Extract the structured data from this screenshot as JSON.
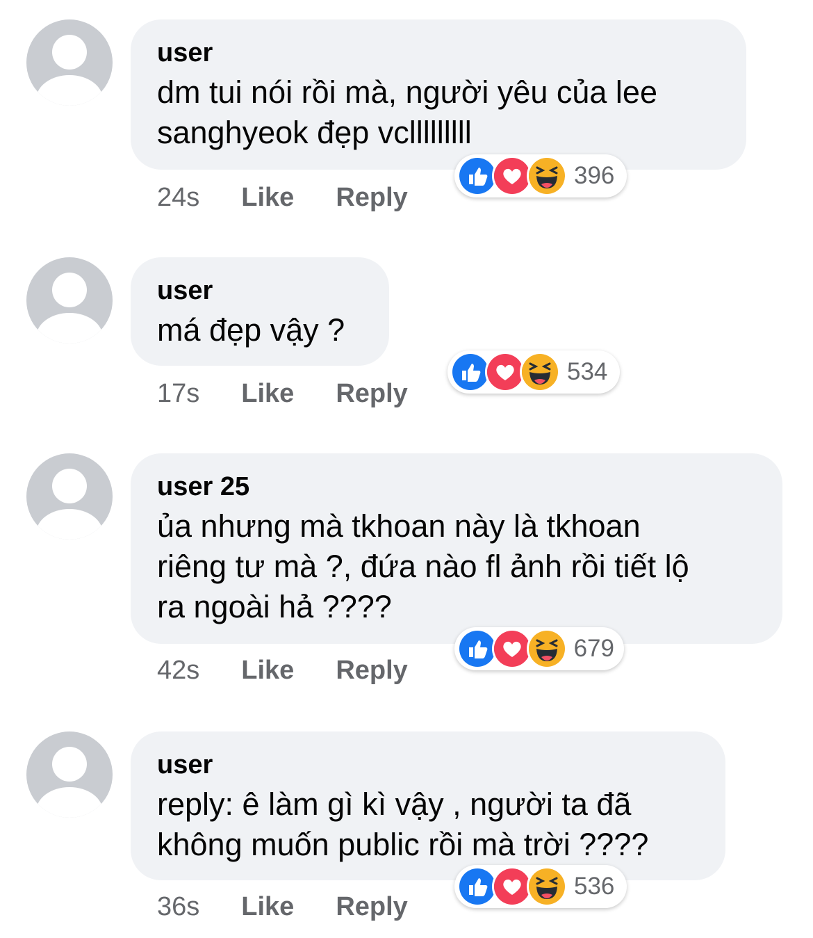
{
  "colors": {
    "bubble_bg": "#f0f2f5",
    "muted_text": "#65676b",
    "like_blue": "#1877f2",
    "love_red": "#f33e58",
    "haha_yellow": "#f7b125"
  },
  "comments": [
    {
      "author": "user",
      "text_lines": [
        "dm tui nói rồi mà, người yêu của lee",
        "sanghyeok đẹp vclllllllll"
      ],
      "time": "24s",
      "like_label": "Like",
      "reply_label": "Reply",
      "reaction_icons": [
        "like-icon",
        "love-icon",
        "haha-icon"
      ],
      "reaction_count": "396"
    },
    {
      "author": "user",
      "text_lines": [
        "má đẹp vậy ?"
      ],
      "time": "17s",
      "like_label": "Like",
      "reply_label": "Reply",
      "reaction_icons": [
        "like-icon",
        "love-icon",
        "haha-icon"
      ],
      "reaction_count": "534"
    },
    {
      "author": "user 25",
      "text_lines": [
        "ủa nhưng mà tkhoan này là tkhoan",
        "riêng tư mà ?, đứa nào fl ảnh rồi tiết lộ",
        "ra ngoài hả ????"
      ],
      "time": "42s",
      "like_label": "Like",
      "reply_label": "Reply",
      "reaction_icons": [
        "like-icon",
        "love-icon",
        "haha-icon"
      ],
      "reaction_count": "679"
    },
    {
      "author": "user",
      "text_lines": [
        "reply: ê làm gì kì vậy , người ta đã",
        "không muốn public rồi mà trời ????"
      ],
      "time": "36s",
      "like_label": "Like",
      "reply_label": "Reply",
      "reaction_icons": [
        "like-icon",
        "love-icon",
        "haha-icon"
      ],
      "reaction_count": "536"
    }
  ]
}
